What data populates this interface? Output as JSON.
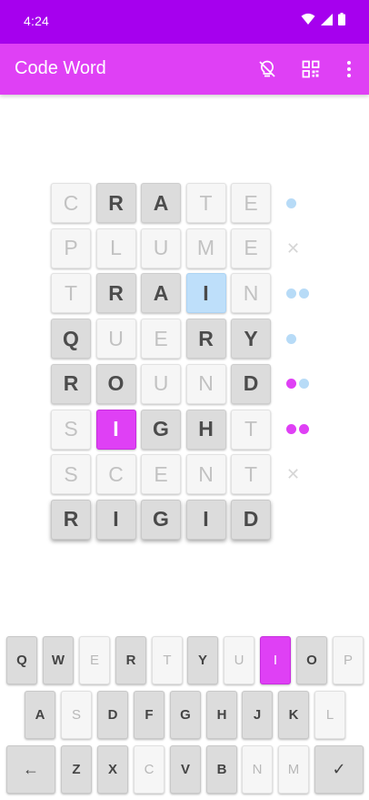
{
  "status_bar": {
    "time": "4:24"
  },
  "app_bar": {
    "title": "Code Word",
    "icons": [
      "hint-off-icon",
      "qr-code-icon",
      "more-vert-icon"
    ]
  },
  "colors": {
    "status_bar": "#a600ee",
    "app_bar": "#df40f5",
    "hint_pink": "#df40f5",
    "hint_blue": "#bedffa",
    "present": "#dcdcdc",
    "absent": "#f6f6f6"
  },
  "board": {
    "rows": [
      {
        "letters": [
          "C",
          "R",
          "A",
          "T",
          "E"
        ],
        "states": [
          "absent",
          "present",
          "present",
          "absent",
          "absent"
        ],
        "marker": [
          "blue"
        ]
      },
      {
        "letters": [
          "P",
          "L",
          "U",
          "M",
          "E"
        ],
        "states": [
          "absent",
          "absent",
          "absent",
          "absent",
          "absent"
        ],
        "marker": [
          "cross"
        ]
      },
      {
        "letters": [
          "T",
          "R",
          "A",
          "I",
          "N"
        ],
        "states": [
          "absent",
          "present",
          "present",
          "hint-blue",
          "absent"
        ],
        "marker": [
          "blue",
          "blue"
        ]
      },
      {
        "letters": [
          "Q",
          "U",
          "E",
          "R",
          "Y"
        ],
        "states": [
          "present",
          "absent",
          "absent",
          "present",
          "present"
        ],
        "marker": [
          "blue"
        ]
      },
      {
        "letters": [
          "R",
          "O",
          "U",
          "N",
          "D"
        ],
        "states": [
          "present",
          "present",
          "absent",
          "absent",
          "present"
        ],
        "marker": [
          "pink",
          "blue"
        ]
      },
      {
        "letters": [
          "S",
          "I",
          "G",
          "H",
          "T"
        ],
        "states": [
          "absent",
          "hint-pink",
          "present",
          "present",
          "absent"
        ],
        "marker": [
          "pink",
          "pink"
        ]
      },
      {
        "letters": [
          "S",
          "C",
          "E",
          "N",
          "T"
        ],
        "states": [
          "absent",
          "absent",
          "absent",
          "absent",
          "absent"
        ],
        "marker": [
          "cross"
        ]
      },
      {
        "letters": [
          "R",
          "I",
          "G",
          "I",
          "D"
        ],
        "states": [
          "answer",
          "answer",
          "answer",
          "answer",
          "answer"
        ],
        "marker": []
      }
    ]
  },
  "keyboard": {
    "rows": [
      [
        {
          "label": "Q",
          "state": "present"
        },
        {
          "label": "W",
          "state": "present"
        },
        {
          "label": "E",
          "state": "absent"
        },
        {
          "label": "R",
          "state": "present"
        },
        {
          "label": "T",
          "state": "absent"
        },
        {
          "label": "Y",
          "state": "present"
        },
        {
          "label": "U",
          "state": "absent"
        },
        {
          "label": "I",
          "state": "pink"
        },
        {
          "label": "O",
          "state": "present"
        },
        {
          "label": "P",
          "state": "absent"
        }
      ],
      [
        {
          "label": "A",
          "state": "present"
        },
        {
          "label": "S",
          "state": "absent"
        },
        {
          "label": "D",
          "state": "present"
        },
        {
          "label": "F",
          "state": "present"
        },
        {
          "label": "G",
          "state": "present"
        },
        {
          "label": "H",
          "state": "present"
        },
        {
          "label": "J",
          "state": "present"
        },
        {
          "label": "K",
          "state": "present"
        },
        {
          "label": "L",
          "state": "absent"
        }
      ],
      [
        {
          "label": "←",
          "state": "action",
          "icon": "backspace-icon"
        },
        {
          "label": "Z",
          "state": "present"
        },
        {
          "label": "X",
          "state": "present"
        },
        {
          "label": "C",
          "state": "absent"
        },
        {
          "label": "V",
          "state": "present"
        },
        {
          "label": "B",
          "state": "present"
        },
        {
          "label": "N",
          "state": "absent"
        },
        {
          "label": "M",
          "state": "absent"
        },
        {
          "label": "✓",
          "state": "action",
          "icon": "check-icon"
        }
      ]
    ]
  }
}
